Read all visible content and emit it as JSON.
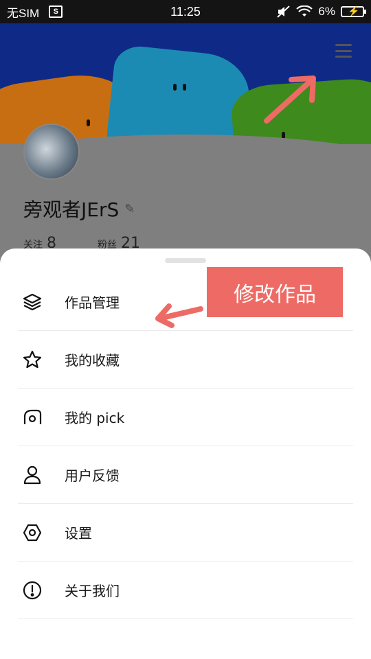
{
  "status_bar": {
    "carrier": "无SIM",
    "sim_badge": "S",
    "time": "11:25",
    "battery_percent": "6%"
  },
  "profile": {
    "username": "旁观者JErS",
    "stats": [
      {
        "label": "关注",
        "value": "8"
      },
      {
        "label": "粉丝",
        "value": "21"
      }
    ]
  },
  "sheet": {
    "items": [
      {
        "label": "作品管理",
        "icon": "layers-icon"
      },
      {
        "label": "我的收藏",
        "icon": "star-icon"
      },
      {
        "label": "我的 pick",
        "icon": "pick-icon"
      },
      {
        "label": "用户反馈",
        "icon": "user-icon"
      },
      {
        "label": "设置",
        "icon": "settings-icon"
      },
      {
        "label": "关于我们",
        "icon": "info-icon"
      }
    ]
  },
  "annotation": {
    "label": "修改作品",
    "color": "#ee6b65"
  }
}
